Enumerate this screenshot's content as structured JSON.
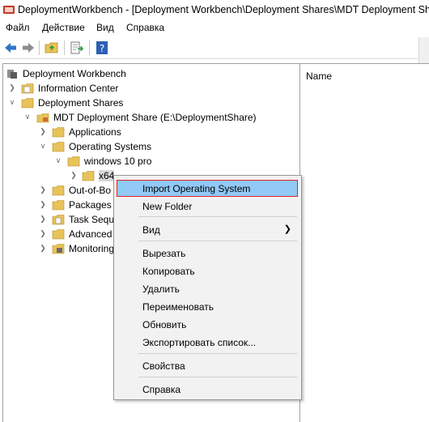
{
  "window": {
    "title": "DeploymentWorkbench - [Deployment Workbench\\Deployment Shares\\MDT Deployment Shar"
  },
  "menu": [
    "Файл",
    "Действие",
    "Вид",
    "Справка"
  ],
  "toolbar": {
    "buttons": [
      "back-arrow-icon",
      "forward-arrow-icon",
      "up-folder-icon",
      "export-list-icon",
      "help-icon"
    ]
  },
  "tree": {
    "root": "Deployment Workbench",
    "information_center": "Information Center",
    "deployment_shares": "Deployment Shares",
    "mdt_share": "MDT Deployment Share (E:\\DeploymentShare)",
    "applications": "Applications",
    "operating_systems": "Operating Systems",
    "windows10": "windows 10 pro",
    "x64": "x64",
    "out_of_box": "Out-of-Bo",
    "packages": "Packages",
    "task_sequences": "Task Seque",
    "advanced": "Advanced",
    "monitoring": "Monitoring"
  },
  "list_pane": {
    "column_name": "Name"
  },
  "context_menu": {
    "import_os": "Import Operating System",
    "new_folder": "New Folder",
    "view": "Вид",
    "cut": "Вырезать",
    "copy": "Копировать",
    "delete": "Удалить",
    "rename": "Переименовать",
    "refresh": "Обновить",
    "export_list": "Экспортировать список...",
    "properties": "Свойства",
    "help": "Справка"
  },
  "colors": {
    "highlight": "#91c9f7",
    "highlight_border": "#e52222",
    "folder": "#e8c25a"
  }
}
